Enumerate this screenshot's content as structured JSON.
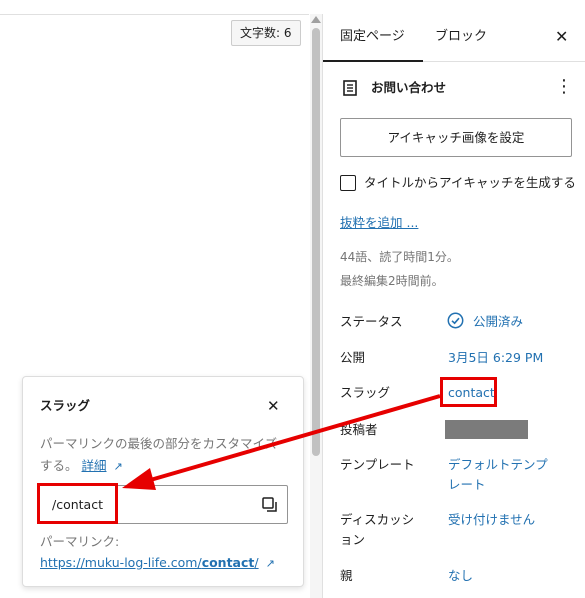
{
  "editor": {
    "word_count": "文字数: 6"
  },
  "sidebar": {
    "tabs": [
      {
        "label": "固定ページ"
      },
      {
        "label": "ブロック"
      }
    ],
    "close_label": "✕",
    "page": {
      "icon": "page-icon",
      "title": "お問い合わせ",
      "more_label": "⋮"
    },
    "featured_image_button": "アイキャッチ画像を設定",
    "generate_checkbox_label": "タイトルからアイキャッチを生成する",
    "add_excerpt_link": "抜粋を追加 ...",
    "meta_line1": "44語、読了時間1分。",
    "meta_line2": "最終編集2時間前。",
    "rows": {
      "status": {
        "label": "ステータス",
        "value": "公開済み",
        "icon": "check-circle-icon"
      },
      "publish": {
        "label": "公開",
        "value": "3月5日 6:29 PM"
      },
      "slug": {
        "label": "スラッグ",
        "value": "contact"
      },
      "author": {
        "label": "投稿者"
      },
      "template": {
        "label": "テンプレート",
        "value_line1": "デフォルトテンプ",
        "value_line2": "レート"
      },
      "discussion": {
        "label_line1": "ディスカッシ",
        "label_line2": "ョン",
        "value": "受け付けません"
      },
      "parent": {
        "label": "親",
        "value": "なし"
      }
    }
  },
  "slug_popover": {
    "title": "スラッグ",
    "close_label": "✕",
    "description_line1": "パーマリンクの最後の部分をカスタマイズ",
    "description_line2_prefix": "する。",
    "details_link": "詳細",
    "external_arrow": "↗",
    "slug_value": "/contact",
    "permalink_label": "パーマリンク:",
    "permalink_base": "https://muku-log-life.com/",
    "permalink_slug": "contact",
    "permalink_suffix": "/"
  },
  "colors": {
    "link": "#2271b1",
    "annotation": "#e60000",
    "text": "#1e1e1e",
    "muted": "#757575"
  }
}
